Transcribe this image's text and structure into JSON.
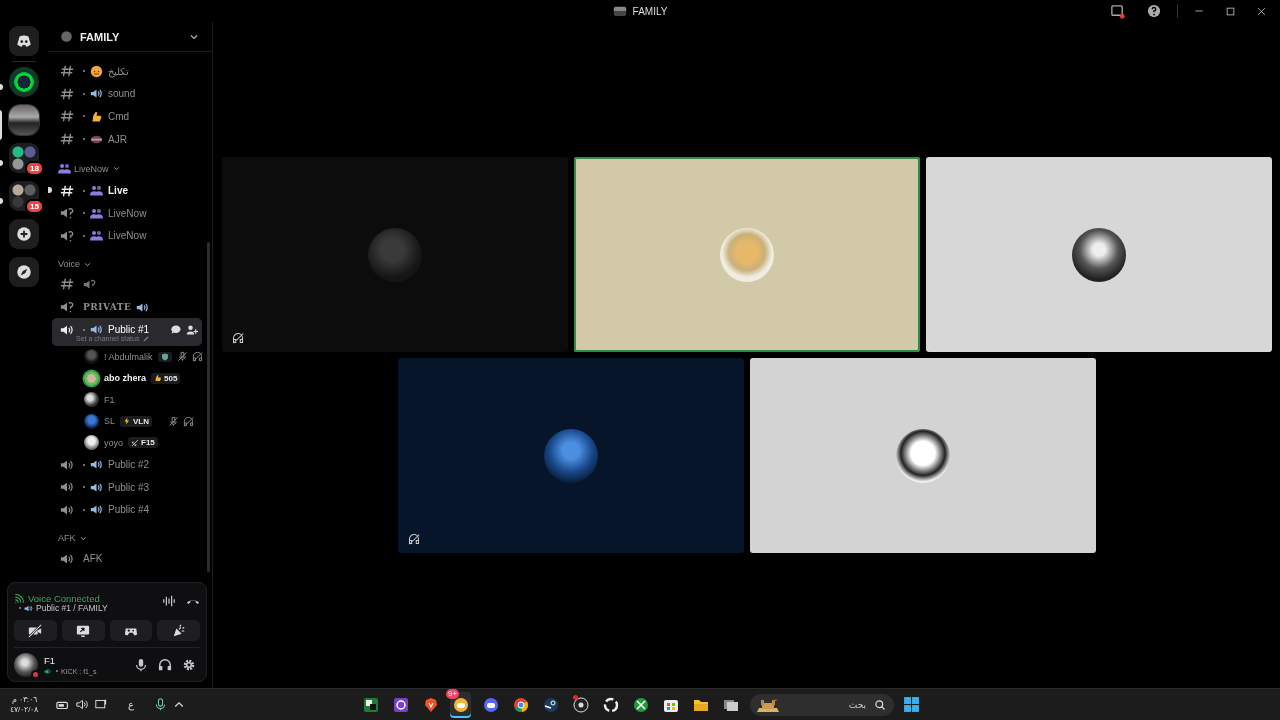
{
  "window": {
    "title": "FAMILY"
  },
  "servers": [
    {
      "kind": "home",
      "selected": false,
      "unread": false
    },
    {
      "kind": "server",
      "selected": false,
      "unread": true
    },
    {
      "kind": "server",
      "selected": true,
      "unread": false
    },
    {
      "kind": "folder",
      "selected": false,
      "unread": true,
      "badge": "18"
    },
    {
      "kind": "folder",
      "selected": false,
      "unread": true,
      "badge": "15"
    },
    {
      "kind": "add",
      "selected": false,
      "unread": false
    },
    {
      "kind": "explore",
      "selected": false,
      "unread": false
    }
  ],
  "guild": {
    "name": "FAMILY"
  },
  "channel_groups": [
    {
      "channels": [
        {
          "kind": "text",
          "emoji": {
            "kind": "face"
          },
          "name": "تكليخ",
          "selected": false,
          "unread": false
        },
        {
          "kind": "text",
          "emoji": {
            "kind": "speaker"
          },
          "name": "sound",
          "selected": false,
          "unread": false
        },
        {
          "kind": "text",
          "emoji": {
            "kind": "hand"
          },
          "name": "Cmd",
          "selected": false,
          "unread": false
        },
        {
          "kind": "text",
          "emoji": {
            "kind": "mask"
          },
          "name": "AJR",
          "selected": false,
          "unread": false
        }
      ]
    },
    {
      "category": "LiveNow",
      "emoji": {
        "kind": "people"
      },
      "channels": [
        {
          "kind": "text",
          "emoji": {
            "kind": "people"
          },
          "name": "Live",
          "selected": false,
          "unread": true
        },
        {
          "kind": "stage",
          "emoji": {
            "kind": "people"
          },
          "name": "LiveNow",
          "selected": false,
          "unread": false
        },
        {
          "kind": "stage",
          "emoji": {
            "kind": "people"
          },
          "name": "LiveNow",
          "selected": false,
          "unread": false
        }
      ]
    },
    {
      "category": "Voice",
      "channels": [
        {
          "kind": "text",
          "emoji": {
            "kind": "stage"
          },
          "selected": false,
          "unread": false
        },
        {
          "kind": "stage",
          "name": "PRIVATE",
          "emoji_after": {
            "kind": "speaker"
          },
          "selected": false,
          "unread": false
        },
        {
          "kind": "voice",
          "emoji": {
            "kind": "speaker"
          },
          "name": "Public #1",
          "selected": true,
          "unread": false,
          "status_placeholder": "Set a channel status",
          "members": [
            {
              "name": "! Abdulmalik",
              "speaking": false,
              "muted": true,
              "deafened": true,
              "tag": {
                "emoji": {
                  "kind": "shield"
                }
              }
            },
            {
              "name": "abo zhera",
              "speaking": true,
              "muted": false,
              "deafened": false,
              "tag": {
                "emoji": {
                  "kind": "hand"
                },
                "text": "505"
              }
            },
            {
              "name": "F1",
              "speaking": false,
              "muted": false,
              "deafened": false
            },
            {
              "name": "SL",
              "speaking": false,
              "muted": true,
              "deafened": true,
              "tag": {
                "emoji": {
                  "kind": "bolt"
                },
                "text": "VLN"
              }
            },
            {
              "name": "yoyo",
              "speaking": false,
              "muted": false,
              "deafened": false,
              "tag": {
                "emoji": {
                  "kind": "plane"
                },
                "text": "F15"
              }
            }
          ]
        },
        {
          "kind": "voice",
          "emoji": {
            "kind": "speaker"
          },
          "name": "Public #2",
          "selected": false,
          "unread": false
        },
        {
          "kind": "voice",
          "emoji": {
            "kind": "speaker"
          },
          "name": "Public #3",
          "selected": false,
          "unread": false
        },
        {
          "kind": "voice",
          "emoji": {
            "kind": "speaker"
          },
          "name": "Public #4",
          "selected": false,
          "unread": false
        }
      ]
    },
    {
      "category": "AFK",
      "channels": [
        {
          "kind": "voice",
          "name": "AFK",
          "selected": false,
          "unread": false
        }
      ]
    }
  ],
  "voice_panel": {
    "status": "Voice Connected",
    "channel": "Public #1 / FAMILY",
    "buttons": [
      {
        "kind": "camera"
      },
      {
        "kind": "screen"
      },
      {
        "kind": "activity"
      },
      {
        "kind": "soundboard"
      }
    ]
  },
  "user": {
    "name": "F1",
    "custom_status": "KICK : f1_s",
    "presence": {
      "kind": "dnd"
    }
  },
  "tiles": [
    {
      "color": "#0c0c0c",
      "speaking": false,
      "deafened": true
    },
    {
      "color": "#d2c9a9",
      "speaking": true,
      "deafened": false
    },
    {
      "color": "#d7d7d7",
      "speaking": false,
      "deafened": false
    },
    {
      "color": "#06152a",
      "speaking": false,
      "deafened": true
    },
    {
      "color": "#d3d3d3",
      "speaking": false,
      "deafened": false
    }
  ],
  "taskbar": {
    "time": "٠٣:٠٦ م",
    "date": "٤٧/٠٢/٠٨",
    "language": "ع",
    "apps": [
      {
        "kind": "notes",
        "active": false
      },
      {
        "kind": "launcher",
        "active": false
      },
      {
        "kind": "brave",
        "active": false
      },
      {
        "kind": "chat",
        "active": true,
        "badge": "9+"
      },
      {
        "kind": "discord",
        "active": false
      },
      {
        "kind": "chrome",
        "active": false
      },
      {
        "kind": "steam",
        "active": false
      },
      {
        "kind": "recorder",
        "active": false,
        "alert": true
      },
      {
        "kind": "ring",
        "active": false
      },
      {
        "kind": "xbox",
        "active": false
      },
      {
        "kind": "store",
        "active": false
      },
      {
        "kind": "folder",
        "active": false
      },
      {
        "kind": "windows",
        "active": false
      }
    ],
    "search": {
      "placeholder": "بحث"
    }
  }
}
